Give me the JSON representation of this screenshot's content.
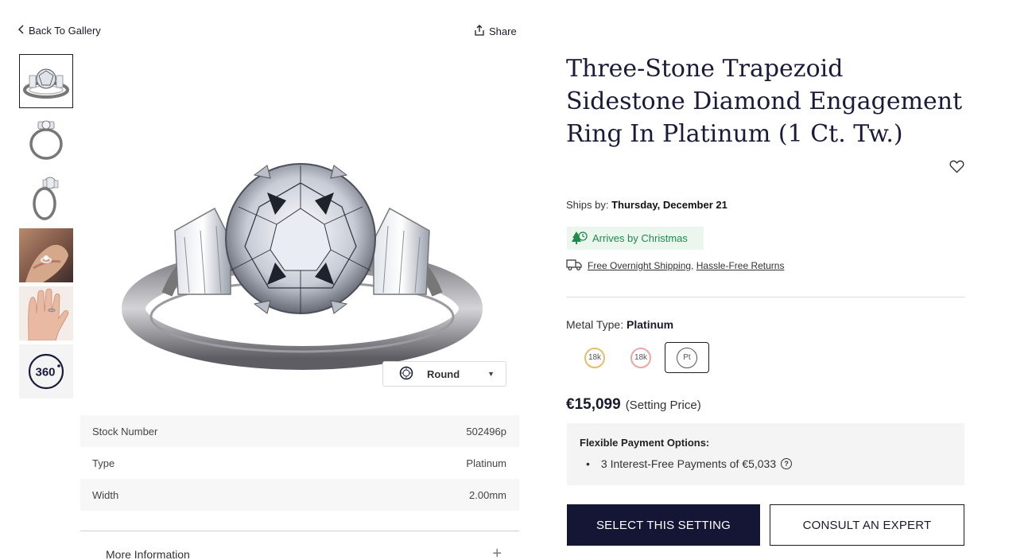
{
  "nav": {
    "back_label": "Back To Gallery",
    "share_label": "Share"
  },
  "gallery": {
    "thumbnails": [
      "ring-front",
      "ring-side",
      "ring-angle",
      "on-hand-photo",
      "hand-photo",
      "360-view"
    ],
    "view_360_label": "360",
    "shape_selector": {
      "label": "Round",
      "icon": "round-diamond-icon"
    }
  },
  "specs": [
    {
      "label": "Stock Number",
      "value": "502496p"
    },
    {
      "label": "Type",
      "value": "Platinum"
    },
    {
      "label": "Width",
      "value": "2.00mm"
    }
  ],
  "more_info_label": "More Information",
  "product": {
    "title": "Three-Stone Trapezoid Sidestone Diamond Engagement Ring In Platinum (1 Ct. Tw.)",
    "ships_by_label": "Ships by:",
    "ships_by_date": "Thursday, December 21",
    "christmas_badge": "Arrives by Christmas",
    "shipping_link": "Free Overnight Shipping",
    "shipping_sep": ",",
    "returns_link": "Hassle-Free Returns",
    "metal_type_label": "Metal Type:",
    "metal_type_value": "Platinum",
    "metal_options": [
      {
        "label": "18k",
        "color": "#e6be6a"
      },
      {
        "label": "18k",
        "color": "#e9a6a4"
      },
      {
        "label": "Pt",
        "color": "#555555",
        "selected": true
      }
    ],
    "price": "€15,099",
    "price_note": "(Setting Price)",
    "payment_heading": "Flexible Payment Options:",
    "payment_item": "3 Interest-Free Payments of €5,033",
    "help_glyph": "?",
    "primary_cta": "SELECT THIS SETTING",
    "secondary_cta": "CONSULT AN EXPERT"
  },
  "colors": {
    "brand_navy": "#151636",
    "christmas_green": "#1f8a49",
    "christmas_bg": "#ebf6ef"
  }
}
